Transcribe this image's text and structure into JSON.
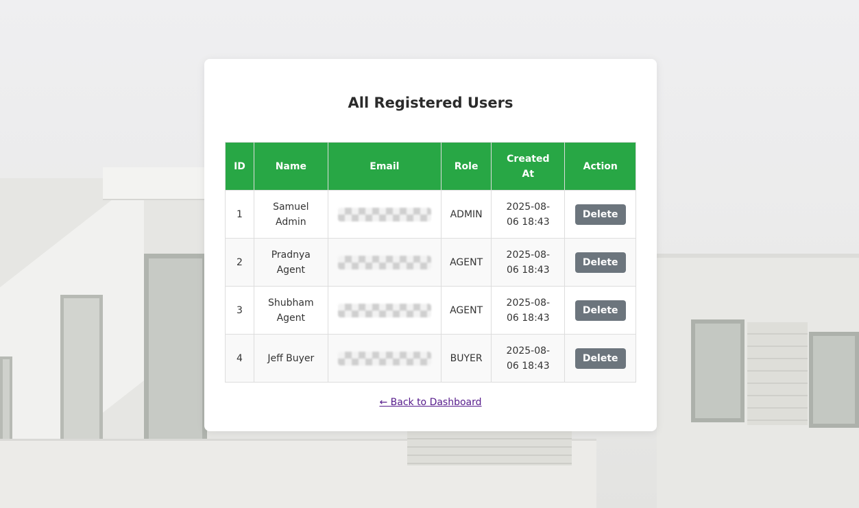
{
  "page": {
    "title": "All Registered Users",
    "back_link": "← Back to Dashboard"
  },
  "colors": {
    "header_bg": "#28a745",
    "delete_button_bg": "#6c757d",
    "link": "#551a8b"
  },
  "table": {
    "headers": {
      "id": "ID",
      "name": "Name",
      "email": "Email",
      "role": "Role",
      "created_at": "Created At",
      "action": "Action"
    },
    "rows": [
      {
        "id": "1",
        "name": "Samuel Admin",
        "role": "ADMIN",
        "created_at": "2025-08-06 18:43",
        "action": "Delete"
      },
      {
        "id": "2",
        "name": "Pradnya Agent",
        "role": "AGENT",
        "created_at": "2025-08-06 18:43",
        "action": "Delete"
      },
      {
        "id": "3",
        "name": "Shubham Agent",
        "role": "AGENT",
        "created_at": "2025-08-06 18:43",
        "action": "Delete"
      },
      {
        "id": "4",
        "name": "Jeff Buyer",
        "role": "BUYER",
        "created_at": "2025-08-06 18:43",
        "action": "Delete"
      }
    ]
  }
}
